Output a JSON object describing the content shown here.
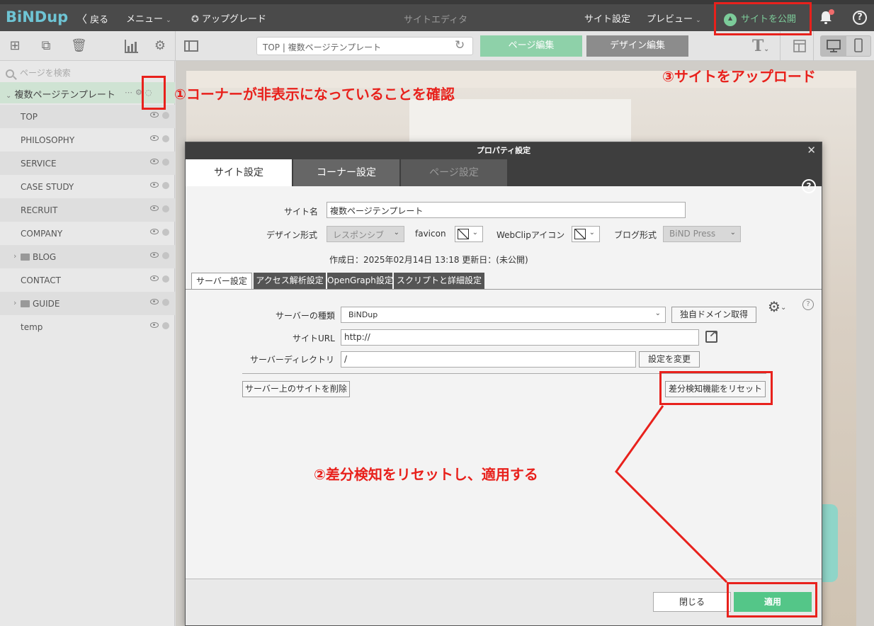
{
  "header": {
    "logo": "BiNDup",
    "back": "戻る",
    "menu": "メニュー",
    "upgrade": "アップグレード",
    "center_title": "サイトエディタ",
    "site_settings": "サイト設定",
    "preview": "プレビュー",
    "publish": "サイトを公開"
  },
  "toolbar": {
    "url_value": "TOP | 複数ページテンプレート",
    "page_edit": "ページ編集",
    "design_edit": "デザイン編集"
  },
  "sidebar": {
    "search_placeholder": "ページを検索",
    "root": "複数ページテンプレート",
    "pages": [
      "TOP",
      "PHILOSOPHY",
      "SERVICE",
      "CASE STUDY",
      "RECRUIT",
      "COMPANY",
      "BLOG",
      "CONTACT",
      "GUIDE",
      "temp"
    ]
  },
  "dialog": {
    "title": "プロパティ設定",
    "tabs": [
      "サイト設定",
      "コーナー設定",
      "ページ設定"
    ],
    "site_name_label": "サイト名",
    "site_name_value": "複数ページテンプレート",
    "design_format_label": "デザイン形式",
    "design_format_value": "レスポンシブ",
    "favicon_label": "favicon",
    "webclip_label": "WebClipアイコン",
    "blog_format_label": "ブログ形式",
    "blog_format_value": "BiND Press",
    "dates": "作成日：2025年02月14日 13:18 更新日：(未公開)",
    "subtabs": [
      "サーバー設定",
      "アクセス解析設定",
      "OpenGraph設定",
      "スクリプトと詳細設定"
    ],
    "server_type_label": "サーバーの種類",
    "server_type_value": "BiNDup",
    "own_domain_button": "独自ドメイン取得",
    "site_url_label": "サイトURL",
    "site_url_value": "http://",
    "server_dir_label": "サーバーディレクトリ",
    "server_dir_value": "/",
    "change_button": "設定を変更",
    "delete_button": "サーバー上のサイトを削除",
    "reset_button": "差分検知機能をリセット",
    "close_button": "閉じる",
    "apply_button": "適用"
  },
  "annotations": {
    "step1": "①コーナーが非表示になっていることを確認",
    "step2": "②差分検知をリセットし、適用する",
    "step3": "③サイトをアップロード",
    "color": "#e8211c"
  }
}
